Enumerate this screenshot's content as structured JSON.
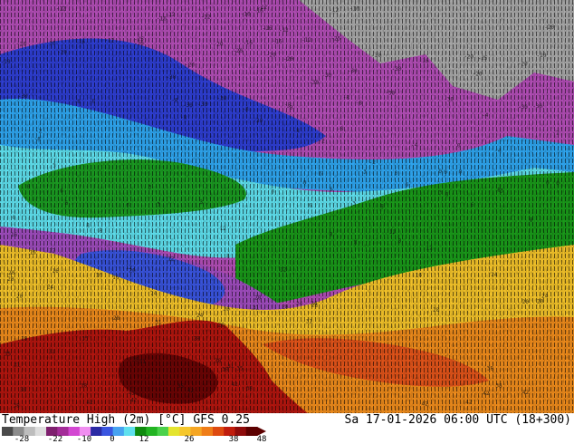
{
  "title": "Temperature High (2m) [°C] GFS 0.25",
  "timestamp": "Sa 17-01-2026 06:00 UTC (18+300)",
  "legend": {
    "ticks": [
      "-28",
      "-22",
      "-10",
      "0",
      "12",
      "26",
      "38",
      "48"
    ],
    "colors": [
      "#4a4a4a",
      "#8c8c8c",
      "#bdbdbd",
      "#dddddd",
      "#7e1f6e",
      "#a32c98",
      "#d347d2",
      "#f08ef0",
      "#2a2aa4",
      "#3a55e0",
      "#47a3f0",
      "#5fe0ee",
      "#0e8a0e",
      "#22b422",
      "#4ad14a",
      "#e4e42e",
      "#f5c72c",
      "#f5a623",
      "#ef7d18",
      "#de4a10",
      "#c01d0d",
      "#8e0b0b",
      "#5c0000"
    ]
  },
  "map": {
    "label_values": [
      "-12",
      "-16",
      "-20",
      "-25",
      "-30",
      "-8",
      "-4",
      "-2",
      "0",
      "3",
      "6",
      "8",
      "12",
      "16",
      "20",
      "24",
      "28",
      "31",
      "35",
      "38",
      "42"
    ]
  }
}
